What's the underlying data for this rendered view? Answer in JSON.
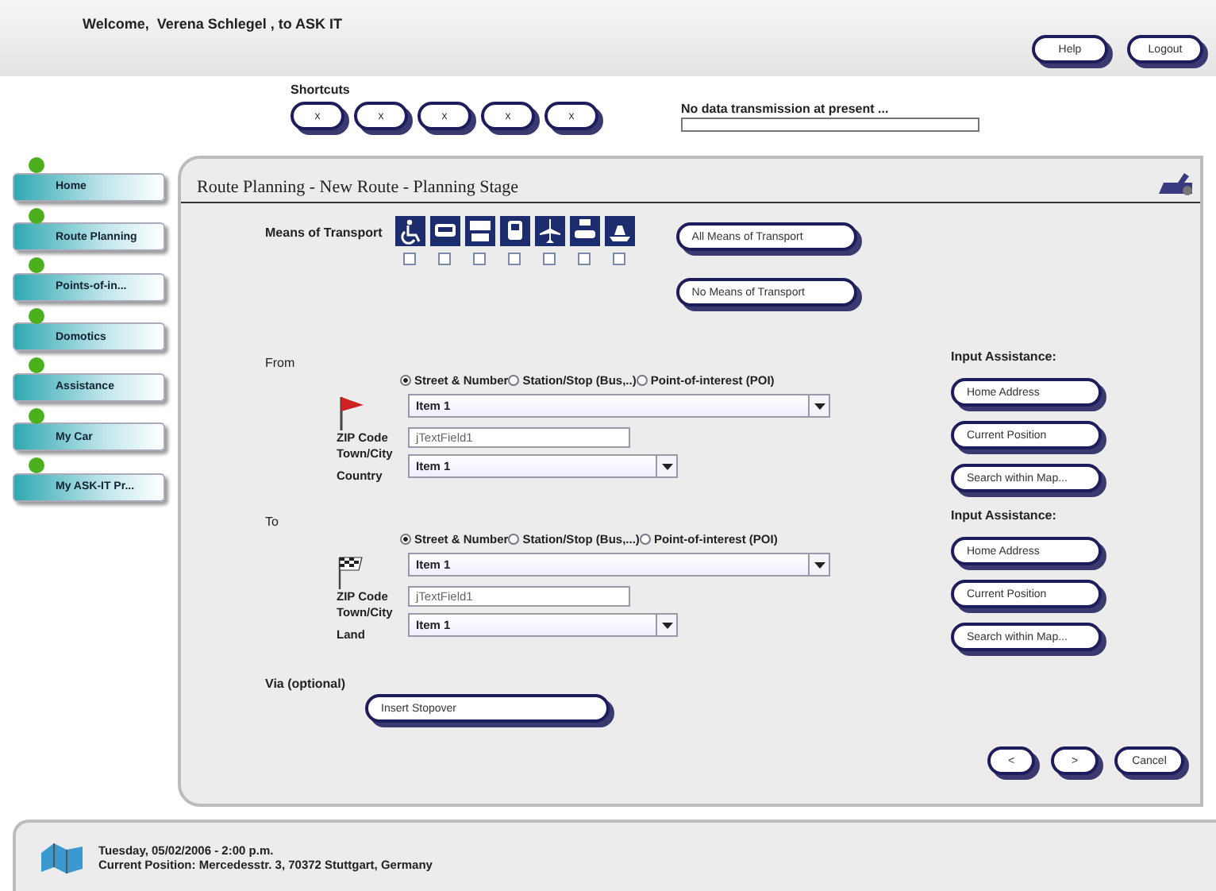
{
  "header": {
    "welcome": "Welcome,  Verena Schlegel , to ASK IT",
    "buttons": [
      "Help",
      "Logout"
    ]
  },
  "shortcuts": {
    "label": "Shortcuts",
    "buttons": [
      "x",
      "x",
      "x",
      "x",
      "x"
    ]
  },
  "status": {
    "message": "No data transmission at present ..."
  },
  "sidebar": {
    "items": [
      "Home",
      "Route Planning",
      "Points-of-in...",
      "Domotics",
      "Assistance",
      "My Car",
      "My ASK-IT Pr..."
    ]
  },
  "panel": {
    "title": "Route Planning - New Route - Planning Stage"
  },
  "transport": {
    "label": "Means of Transport",
    "options": [
      {
        "checked": false
      },
      {
        "checked": false
      },
      {
        "checked": false
      },
      {
        "checked": false
      },
      {
        "checked": false
      },
      {
        "checked": false
      },
      {
        "checked": false
      }
    ],
    "buttons": [
      "All Means of Transport",
      "No Means of Transport"
    ]
  },
  "sections": [
    {
      "label": "From",
      "kind": "start",
      "options": [
        {
          "label": "Street & Number",
          "selected": true
        },
        {
          "label": "Station/Stop (Bus,..)",
          "selected": false
        },
        {
          "label": "Point-of-interest (POI)",
          "selected": false
        }
      ],
      "street_select": "Item 1",
      "zip_labels": [
        "ZIP Code",
        "Town/City"
      ],
      "zip_value": "jTextField1",
      "country_label": "Country",
      "country_select": "Item 1",
      "assist_title": "Input Assistance:",
      "assist_buttons": [
        "Home Address",
        "Current Position",
        "Search within Map..."
      ]
    },
    {
      "label": "To",
      "kind": "finish",
      "options": [
        {
          "label": "Street & Number",
          "selected": true
        },
        {
          "label": "Station/Stop (Bus,...)",
          "selected": false
        },
        {
          "label": "Point-of-interest (POI)",
          "selected": false
        }
      ],
      "street_select": "Item 1",
      "zip_labels": [
        "ZIP Code",
        "Town/City"
      ],
      "zip_value": "jTextField1",
      "country_label": "Land",
      "country_select": "Item 1",
      "assist_title": "Input Assistance:",
      "assist_buttons": [
        "Home Address",
        "Current Position",
        "Search within Map..."
      ]
    }
  ],
  "via": {
    "label": "Via (optional)",
    "button": "Insert Stopover"
  },
  "nav": [
    "<",
    ">",
    "Cancel"
  ],
  "footer": {
    "lines": [
      "Tuesday, 05/02/2006 - 2:00 p.m.",
      "Current Position: Mercedesstr. 3, 70372 Stuttgart, Germany"
    ]
  }
}
